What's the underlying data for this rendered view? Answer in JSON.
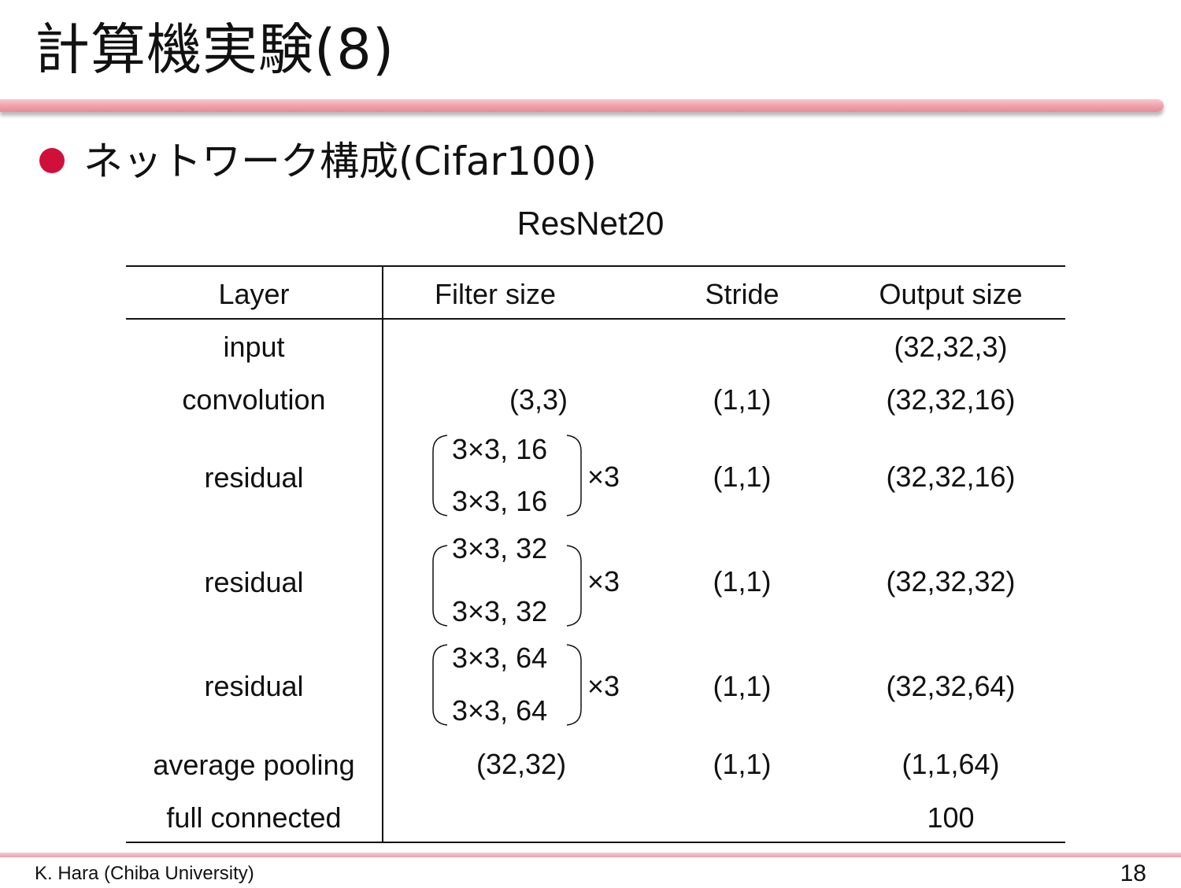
{
  "slide": {
    "title": "計算機実験(8)",
    "bullet": "ネットワーク構成(Cifar100)"
  },
  "table": {
    "caption": "ResNet20",
    "headers": [
      "Layer",
      "Filter size",
      "Stride",
      "Output size"
    ],
    "rows": [
      {
        "layer": "input",
        "filter": "",
        "stride": "",
        "output": "(32,32,3)"
      },
      {
        "layer": "convolution",
        "filter": "(3,3)",
        "stride": "(1,1)",
        "output": "(32,32,16)"
      },
      {
        "layer": "residual",
        "filter_top": "3×3, 16",
        "filter_bottom": "3×3, 16",
        "repeat": "×3",
        "stride": "(1,1)",
        "output": "(32,32,16)"
      },
      {
        "layer": "residual",
        "filter_top": "3×3, 32",
        "filter_bottom": "3×3, 32",
        "repeat": "×3",
        "stride": "(1,1)",
        "output": "(32,32,32)"
      },
      {
        "layer": "residual",
        "filter_top": "3×3, 64",
        "filter_bottom": "3×3, 64",
        "repeat": "×3",
        "stride": "(1,1)",
        "output": "(32,32,64)"
      },
      {
        "layer": "average pooling",
        "filter": "(32,32)",
        "stride": "(1,1)",
        "output": "(1,1,64)"
      },
      {
        "layer": "full connected",
        "filter": "",
        "stride": "",
        "output": "100"
      }
    ]
  },
  "footer": {
    "author": "K. Hara (Chiba University)",
    "page": "18"
  },
  "colors": {
    "bullet": "#d0103a",
    "accent_rule": "#efa0aa"
  }
}
